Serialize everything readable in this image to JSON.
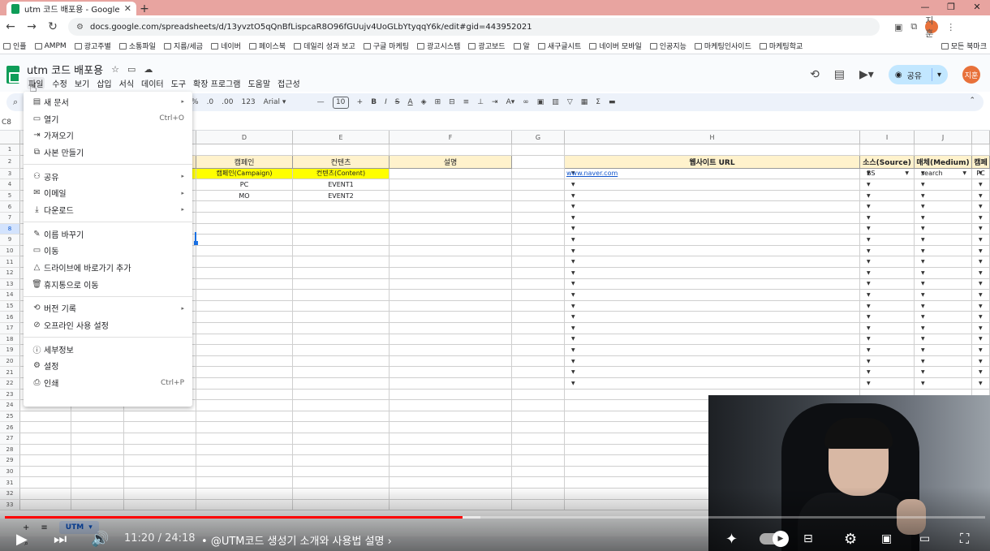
{
  "browser": {
    "tab_title": "utm 코드 배포용 - Google Sh",
    "url": "docs.google.com/spreadsheets/d/13yvztO5qQnBfLispcaR8O96fGUujv4UoGLbYtyqqY6k/edit#gid=443952021",
    "profile_initials": "지훈",
    "bookmarks": [
      "인플",
      "AMPM",
      "광고주별",
      "소통파일",
      "지름/세금",
      "네이버",
      "페이스북",
      "데일리 성과 보고",
      "구글 마케팅",
      "광고시스템",
      "광고보드",
      "알",
      "새구글시트",
      "네이버 모바일",
      "인공지능",
      "마케팅인사이드",
      "마케팅학교"
    ],
    "bookmarks_right": "모든 북마크"
  },
  "sheets": {
    "title": "utm 코드 배포용",
    "menus": [
      "파일",
      "수정",
      "보기",
      "삽입",
      "서식",
      "데이터",
      "도구",
      "확장 프로그램",
      "도움말",
      "접근성"
    ],
    "share_label": "공유",
    "user_initials": "지훈",
    "font_name": "Arial",
    "font_size": "10",
    "zoom_pct": "%",
    "num_fmt": "123",
    "decimal_dec": ".0",
    "decimal_inc": ".00",
    "name_box": "C8"
  },
  "file_menu": {
    "items": [
      {
        "icon": "new-doc",
        "label": "새 문서",
        "submenu": true,
        "shortcut": ""
      },
      {
        "icon": "folder",
        "label": "열기",
        "submenu": false,
        "shortcut": "Ctrl+O"
      },
      {
        "icon": "import",
        "label": "가져오기",
        "submenu": false,
        "shortcut": ""
      },
      {
        "icon": "copy",
        "label": "사본 만들기",
        "submenu": false,
        "shortcut": ""
      },
      {
        "icon": "share",
        "label": "공유",
        "submenu": true,
        "shortcut": ""
      },
      {
        "icon": "email",
        "label": "이메일",
        "submenu": true,
        "shortcut": ""
      },
      {
        "icon": "download",
        "label": "다운로드",
        "submenu": true,
        "shortcut": ""
      },
      {
        "icon": "rename",
        "label": "이름 바꾸기",
        "submenu": false,
        "shortcut": ""
      },
      {
        "icon": "move",
        "label": "이동",
        "submenu": false,
        "shortcut": ""
      },
      {
        "icon": "drive",
        "label": "드라이브에 바로가기 추가",
        "submenu": false,
        "shortcut": ""
      },
      {
        "icon": "trash",
        "label": "휴지통으로 이동",
        "submenu": false,
        "shortcut": ""
      },
      {
        "icon": "history",
        "label": "버전 기록",
        "submenu": true,
        "shortcut": ""
      },
      {
        "icon": "offline",
        "label": "오프라인 사용 설정",
        "submenu": false,
        "shortcut": ""
      },
      {
        "icon": "info",
        "label": "세부정보",
        "submenu": false,
        "shortcut": ""
      },
      {
        "icon": "settings",
        "label": "설정",
        "submenu": false,
        "shortcut": ""
      },
      {
        "icon": "print",
        "label": "인쇄",
        "submenu": false,
        "shortcut": "Ctrl+P"
      }
    ]
  },
  "grid": {
    "columns": [
      "D",
      "E",
      "F",
      "G",
      "H",
      "I",
      "J"
    ],
    "rows": [
      "1",
      "2",
      "3",
      "4",
      "5",
      "6",
      "7",
      "8",
      "9",
      "10",
      "11",
      "12",
      "13",
      "14",
      "15",
      "16",
      "17",
      "18",
      "19",
      "20",
      "21",
      "22",
      "23",
      "24",
      "25",
      "26",
      "27",
      "28",
      "29",
      "30",
      "31",
      "32",
      "33"
    ],
    "left_headers": {
      "campaign": "캠페인",
      "content": "컨텐츠",
      "desc": "설명"
    },
    "left_sub": {
      "campaign": "캠페인(Campaign)",
      "content": "컨텐츠(Content)"
    },
    "left_rows": [
      {
        "campaign": "PC",
        "content": "EVENT1"
      },
      {
        "campaign": "MO",
        "content": "EVENT2"
      }
    ],
    "right_headers": {
      "url": "웹사이트 URL",
      "source": "소스(Source)",
      "medium": "매체(Medium)",
      "campaign": "캠페"
    },
    "right_first_row": {
      "url": "www.naver.com",
      "source": "BS",
      "medium": "search",
      "campaign": "PC"
    }
  },
  "sheet_tab": "UTM",
  "video": {
    "time": "11:20 / 24:18",
    "chapter": "@UTM코드 생성기 소개와 사용법 설명",
    "progress": 0.4667
  }
}
